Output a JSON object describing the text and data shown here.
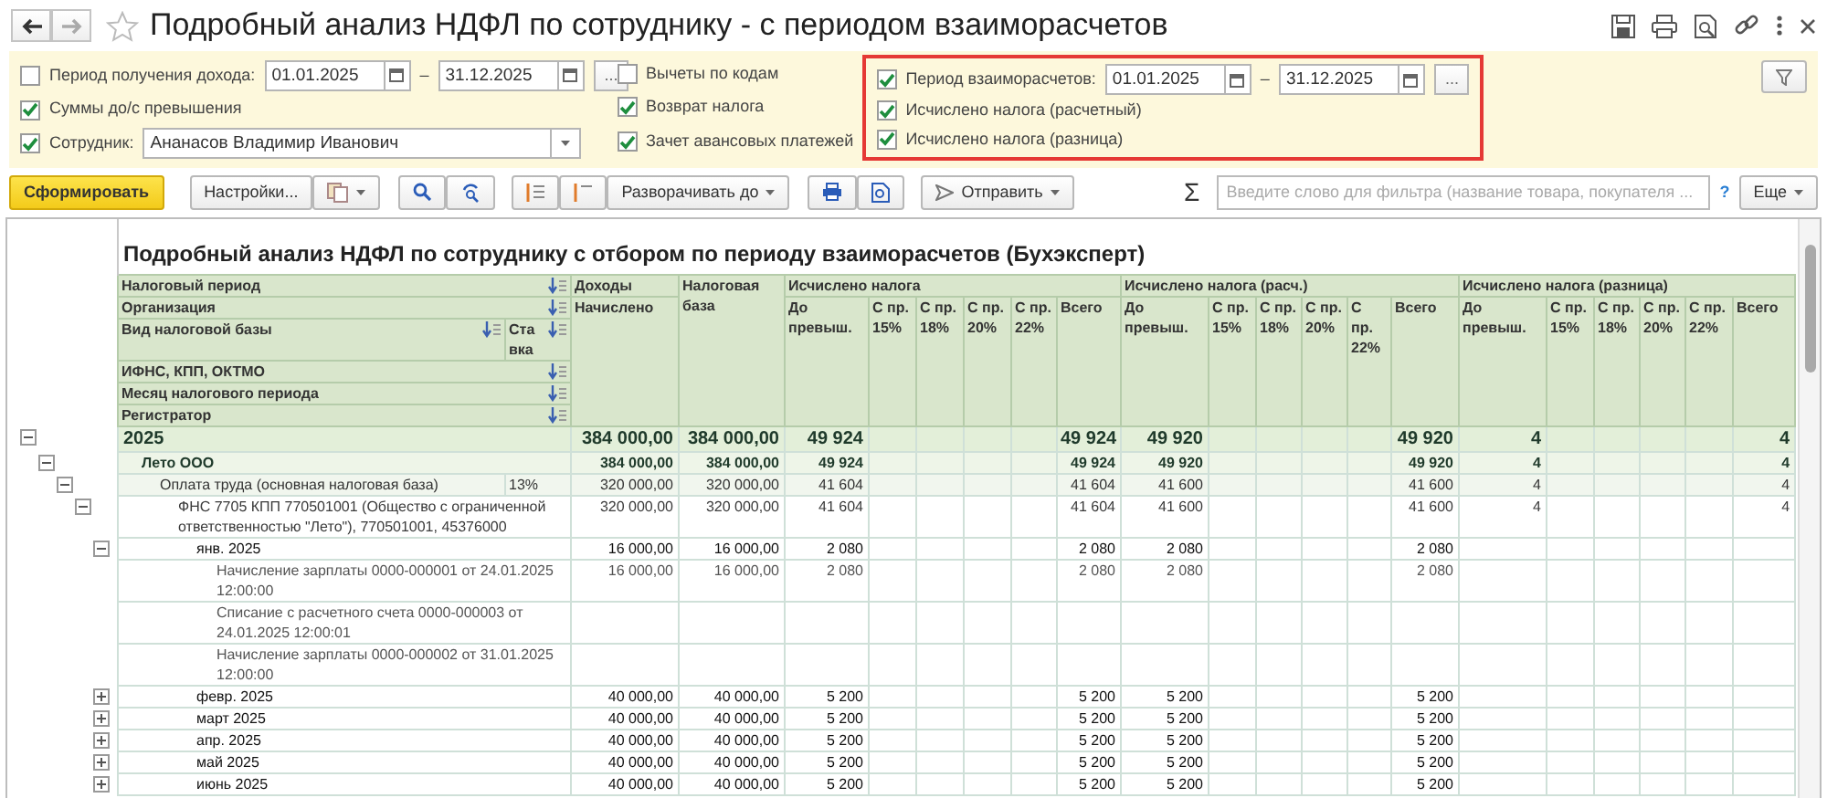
{
  "window": {
    "title": "Подробный анализ НДФЛ по сотруднику - с периодом взаиморасчетов"
  },
  "filters": {
    "income_period": {
      "checked": false,
      "label": "Период получения дохода:",
      "from": "01.01.2025",
      "to": "31.12.2025",
      "dash": "–",
      "choose": "..."
    },
    "sums": {
      "checked": true,
      "label": "Суммы до/с превышения"
    },
    "employee": {
      "checked": true,
      "label": "Сотрудник:",
      "value": "Ананасов Владимир Иванович"
    },
    "middle": [
      {
        "checked": false,
        "label": "Вычеты по кодам"
      },
      {
        "checked": true,
        "label": "Возврат налога"
      },
      {
        "checked": true,
        "label": "Зачет авансовых платежей"
      }
    ],
    "settlement_group": {
      "highlighted": true,
      "period": {
        "checked": true,
        "label": "Период взаиморасчетов:",
        "from": "01.01.2025",
        "to": "31.12.2025",
        "dash": "–",
        "choose": "..."
      },
      "options": [
        {
          "checked": true,
          "label": "Исчислено налога (расчетный)"
        },
        {
          "checked": true,
          "label": "Исчислено налога (разница)"
        }
      ]
    }
  },
  "toolbar": {
    "generate": "Сформировать",
    "settings": "Настройки...",
    "expand": "Разворачивать до",
    "send": "Отправить",
    "sum": "Σ",
    "filter_placeholder": "Введите слово для фильтра (название товара, покупателя ...",
    "help": "?",
    "more": "Еще"
  },
  "report": {
    "title": "Подробный анализ НДФЛ по сотруднику с отбором по периоду взаиморасчетов (Бухэксперт)",
    "row_headers": [
      {
        "label": "Налоговый период"
      },
      {
        "label": "Организация"
      },
      {
        "label": "Вид налоговой базы",
        "rate_label": "Ставка"
      },
      {
        "label": "ИФНС, КПП, ОКТМО"
      },
      {
        "label": "Месяц налогового периода"
      },
      {
        "label": "Регистратор"
      }
    ],
    "income": {
      "label": "Доходы",
      "sub": "Начислено"
    },
    "tax_base": "Налоговая база",
    "groups": [
      {
        "label": "Исчислено налога",
        "columns": [
          "До превыш.",
          "С пр. 15%",
          "С пр. 18%",
          "С пр. 20%",
          "С пр. 22%",
          "Всего"
        ]
      },
      {
        "label": "Исчислено налога (расч.)",
        "columns": [
          "До превыш.",
          "С пр. 15%",
          "С пр. 18%",
          "С пр. 20%",
          "С пр. 22%",
          "Всего"
        ]
      },
      {
        "label": "Исчислено налога (разница)",
        "columns": [
          "До превыш.",
          "С пр. 15%",
          "С пр. 18%",
          "С пр. 20%",
          "С пр. 22%",
          "Всего"
        ]
      }
    ],
    "rows": [
      {
        "kind": "year",
        "name": "2025",
        "expanded": true,
        "income": "384 000,00",
        "tax_base": "384 000,00",
        "calculated": {
          "before": "49 924",
          "total": "49 924"
        },
        "estimated": {
          "before": "49 920",
          "total": "49 920"
        },
        "difference": {
          "before": "4",
          "total": "4"
        },
        "children": [
          {
            "kind": "organization",
            "name": "Лето ООО",
            "expanded": true,
            "income": "384 000,00",
            "tax_base": "384 000,00",
            "calculated": {
              "before": "49 924",
              "total": "49 924"
            },
            "estimated": {
              "before": "49 920",
              "total": "49 920"
            },
            "difference": {
              "before": "4",
              "total": "4"
            },
            "children": [
              {
                "kind": "base",
                "name": "Оплата труда (основная налоговая база)",
                "rate": "13%",
                "expanded": true,
                "income": "320 000,00",
                "tax_base": "320 000,00",
                "calculated": {
                  "before": "41 604",
                  "total": "41 604"
                },
                "estimated": {
                  "before": "41 600",
                  "total": "41 600"
                },
                "difference": {
                  "before": "4",
                  "total": "4"
                },
                "children": [
                  {
                    "kind": "inspection",
                    "name": "ФНС 7705 КПП 770501001 (Общество с ограниченной ответственностью \"Лето\"), 770501001, 45376000",
                    "expanded": true,
                    "income": "320 000,00",
                    "tax_base": "320 000,00",
                    "calculated": {
                      "before": "41 604",
                      "total": "41 604"
                    },
                    "estimated": {
                      "before": "41 600",
                      "total": "41 600"
                    },
                    "difference": {
                      "before": "4",
                      "total": "4"
                    },
                    "children": [
                      {
                        "kind": "month",
                        "name": "янв. 2025",
                        "expanded": true,
                        "income": "16 000,00",
                        "tax_base": "16 000,00",
                        "calculated": {
                          "before": "2 080",
                          "total": "2 080"
                        },
                        "estimated": {
                          "before": "2 080",
                          "total": "2 080"
                        },
                        "children": [
                          {
                            "kind": "document",
                            "name": "Начисление зарплаты 0000-000001 от 24.01.2025 12:00:00",
                            "income": "16 000,00",
                            "tax_base": "16 000,00",
                            "calculated": {
                              "before": "2 080",
                              "total": "2 080"
                            },
                            "estimated": {
                              "before": "2 080",
                              "total": "2 080"
                            }
                          },
                          {
                            "kind": "document",
                            "name": "Списание с расчетного счета 0000-000003 от 24.01.2025 12:00:01"
                          },
                          {
                            "kind": "document",
                            "name": "Начисление зарплаты 0000-000002 от 31.01.2025 12:00:00"
                          }
                        ]
                      },
                      {
                        "kind": "month",
                        "name": "февр. 2025",
                        "expanded": false,
                        "income": "40 000,00",
                        "tax_base": "40 000,00",
                        "calculated": {
                          "before": "5 200",
                          "total": "5 200"
                        },
                        "estimated": {
                          "before": "5 200",
                          "total": "5 200"
                        }
                      },
                      {
                        "kind": "month",
                        "name": "март 2025",
                        "expanded": false,
                        "income": "40 000,00",
                        "tax_base": "40 000,00",
                        "calculated": {
                          "before": "5 200",
                          "total": "5 200"
                        },
                        "estimated": {
                          "before": "5 200",
                          "total": "5 200"
                        }
                      },
                      {
                        "kind": "month",
                        "name": "апр. 2025",
                        "expanded": false,
                        "income": "40 000,00",
                        "tax_base": "40 000,00",
                        "calculated": {
                          "before": "5 200",
                          "total": "5 200"
                        },
                        "estimated": {
                          "before": "5 200",
                          "total": "5 200"
                        }
                      },
                      {
                        "kind": "month",
                        "name": "май 2025",
                        "expanded": false,
                        "income": "40 000,00",
                        "tax_base": "40 000,00",
                        "calculated": {
                          "before": "5 200",
                          "total": "5 200"
                        },
                        "estimated": {
                          "before": "5 200",
                          "total": "5 200"
                        }
                      },
                      {
                        "kind": "month",
                        "name": "июнь 2025",
                        "expanded": false,
                        "income": "40 000,00",
                        "tax_base": "40 000,00",
                        "calculated": {
                          "before": "5 200",
                          "total": "5 200"
                        },
                        "estimated": {
                          "before": "5 200",
                          "total": "5 200"
                        }
                      }
                    ]
                  }
                ]
              }
            ]
          }
        ]
      }
    ]
  }
}
